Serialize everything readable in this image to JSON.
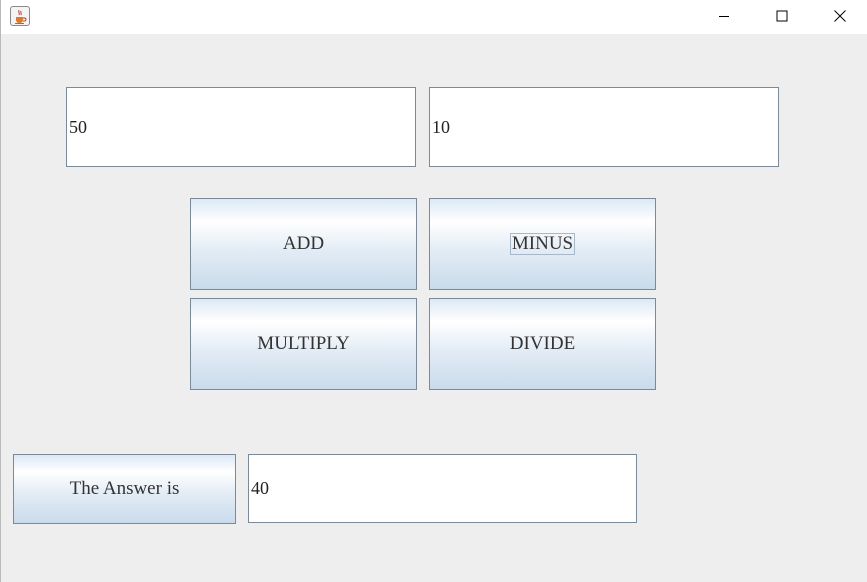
{
  "window": {
    "icon": "java-cup-icon",
    "controls": {
      "minimize": "minimize-icon",
      "maximize": "maximize-icon",
      "close": "close-icon"
    }
  },
  "inputs": {
    "first_number": "50",
    "second_number": "10"
  },
  "buttons": {
    "add": "ADD",
    "minus": "MINUS",
    "multiply": "MULTIPLY",
    "divide": "DIVIDE"
  },
  "result": {
    "label": "The Answer is",
    "value": "40"
  },
  "colors": {
    "background": "#eeeeee",
    "field_border": "#7a8a99",
    "button_gradient_bottom": "#c9dbeb"
  }
}
